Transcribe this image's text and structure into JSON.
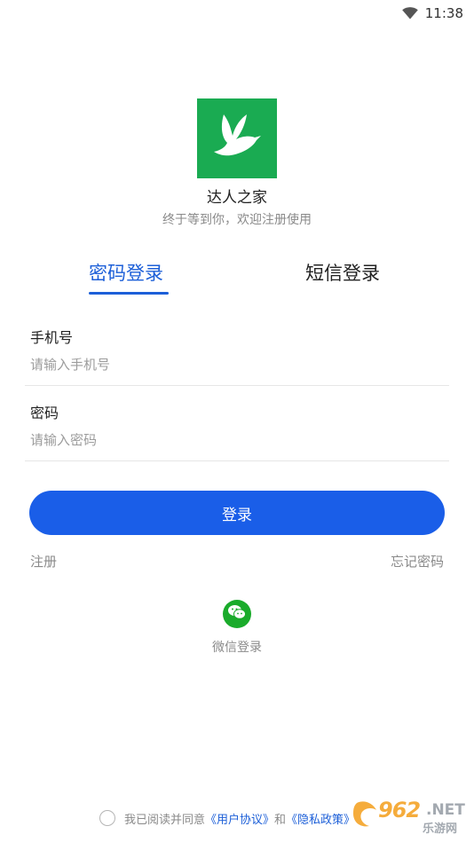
{
  "status_bar": {
    "time": "11:38",
    "wifi_icon": "wifi-icon"
  },
  "app": {
    "name": "达人之家",
    "tagline": "终于等到你，欢迎注册使用",
    "logo_icon": "dove-logo-icon",
    "logo_color": "#1aab52"
  },
  "tabs": [
    {
      "label": "密码登录",
      "active": true
    },
    {
      "label": "短信登录",
      "active": false
    }
  ],
  "form": {
    "phone": {
      "label": "手机号",
      "placeholder": "请输入手机号",
      "value": ""
    },
    "password": {
      "label": "密码",
      "placeholder": "请输入密码",
      "value": ""
    }
  },
  "login_button": {
    "label": "登录",
    "color": "#1a5ee8"
  },
  "links": {
    "register": "注册",
    "forgot_password": "忘记密码"
  },
  "wechat": {
    "label": "微信登录",
    "icon": "wechat-icon",
    "color": "#1aab2b"
  },
  "agreement": {
    "checked": false,
    "prefix": "我已阅读并同意",
    "user_agreement": "《用户协议》",
    "conjunction": "和",
    "privacy_policy": "《隐私政策》"
  },
  "watermark": {
    "digits": "962",
    "suffix": ".NET",
    "cn": "乐游网"
  },
  "accent_color": "#1c5fd8"
}
